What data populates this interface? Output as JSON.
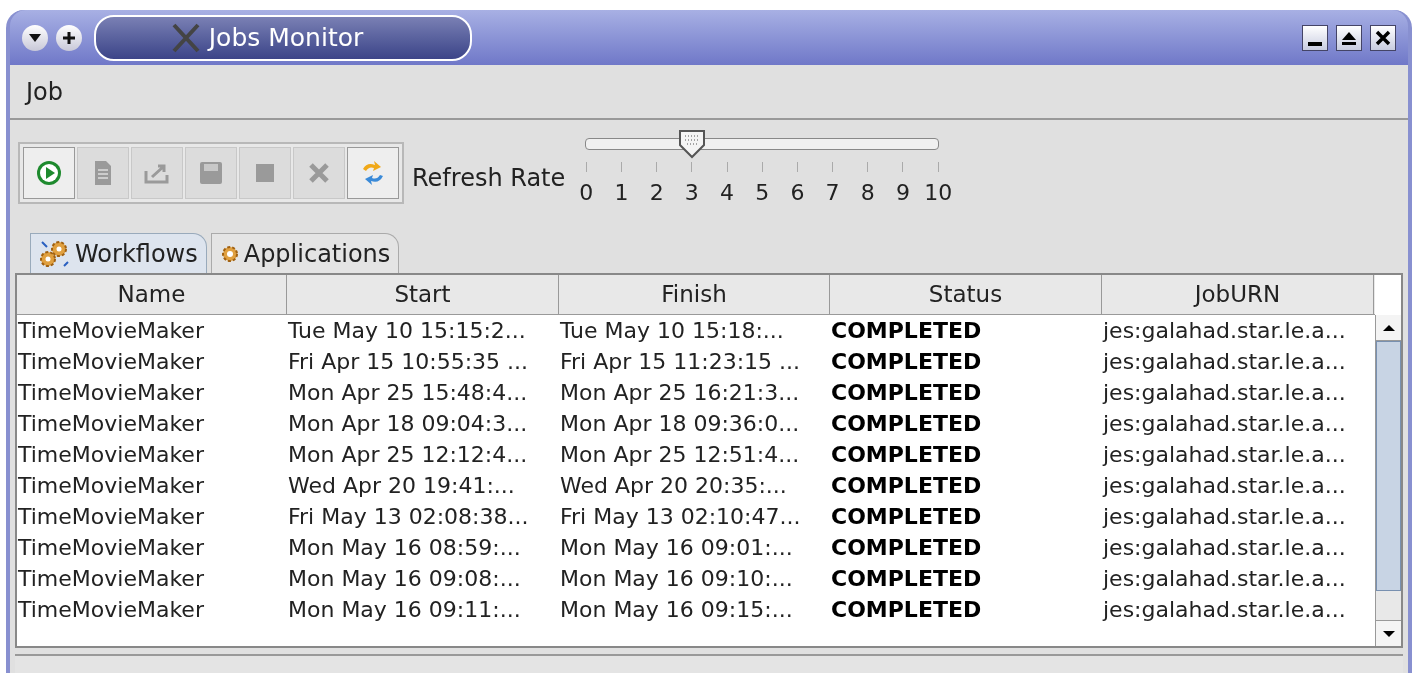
{
  "window": {
    "title": "Jobs Monitor"
  },
  "menu": [
    "Job"
  ],
  "toolbar": [
    {
      "kind": "run",
      "disabled": false
    },
    {
      "kind": "document",
      "disabled": true
    },
    {
      "kind": "export",
      "disabled": true
    },
    {
      "kind": "save",
      "disabled": true
    },
    {
      "kind": "stop",
      "disabled": true
    },
    {
      "kind": "delete",
      "disabled": true
    },
    {
      "kind": "refresh",
      "disabled": false
    }
  ],
  "refresh_rate": {
    "label": "Refresh Rate",
    "level": 0.3,
    "ticks": [
      "0",
      "1",
      "2",
      "3",
      "4",
      "5",
      "6",
      "7",
      "8",
      "9",
      "10"
    ]
  },
  "tabs": [
    {
      "label": "Workflows",
      "selected": true
    },
    {
      "label": "Applications",
      "selected": false
    }
  ],
  "table": {
    "columns": [
      "Name",
      "Start",
      "Finish",
      "Status",
      "JobURN"
    ],
    "rows": [
      [
        "TimeMovieMaker",
        "Tue May 10 15:15:2...",
        "Tue May 10 15:18:...",
        "COMPLETED",
        "jes:galahad.star.le.a..."
      ],
      [
        "TimeMovieMaker",
        "Fri Apr 15 10:55:35 ...",
        "Fri Apr 15 11:23:15 ...",
        "COMPLETED",
        "jes:galahad.star.le.a..."
      ],
      [
        "TimeMovieMaker",
        "Mon Apr 25 15:48:4...",
        "Mon Apr 25 16:21:3...",
        "COMPLETED",
        "jes:galahad.star.le.a..."
      ],
      [
        "TimeMovieMaker",
        "Mon Apr 18 09:04:3...",
        "Mon Apr 18 09:36:0...",
        "COMPLETED",
        "jes:galahad.star.le.a..."
      ],
      [
        "TimeMovieMaker",
        "Mon Apr 25 12:12:4...",
        "Mon Apr 25 12:51:4...",
        "COMPLETED",
        "jes:galahad.star.le.a..."
      ],
      [
        "TimeMovieMaker",
        "Wed Apr 20 19:41:...",
        "Wed Apr 20 20:35:...",
        "COMPLETED",
        "jes:galahad.star.le.a..."
      ],
      [
        "TimeMovieMaker",
        "Fri May 13 02:08:38...",
        "Fri May 13 02:10:47...",
        "COMPLETED",
        "jes:galahad.star.le.a..."
      ],
      [
        "TimeMovieMaker",
        "Mon May 16 08:59:...",
        "Mon May 16 09:01:...",
        "COMPLETED",
        "jes:galahad.star.le.a..."
      ],
      [
        "TimeMovieMaker",
        "Mon May 16 09:08:...",
        "Mon May 16 09:10:...",
        "COMPLETED",
        "jes:galahad.star.le.a..."
      ],
      [
        "TimeMovieMaker",
        "Mon May 16 09:11:...",
        "Mon May 16 09:15:...",
        "COMPLETED",
        "jes:galahad.star.le.a..."
      ]
    ]
  }
}
